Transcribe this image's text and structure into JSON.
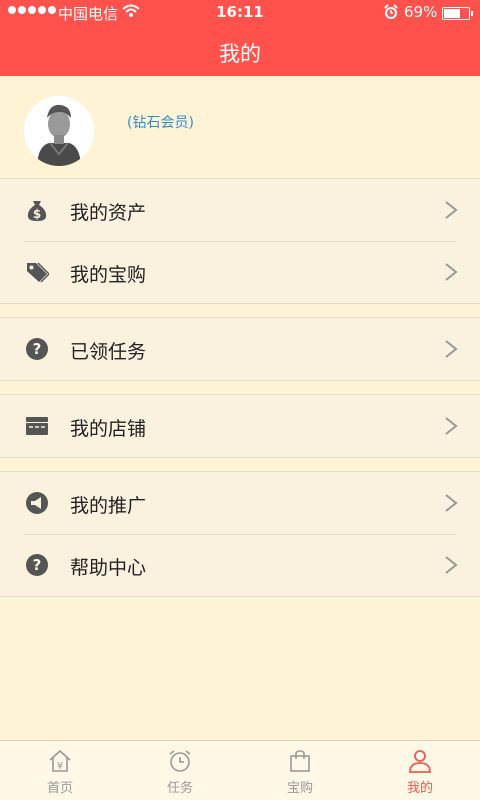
{
  "status_bar": {
    "carrier": "中国电信",
    "time": "16:11",
    "battery_percent": "69%",
    "battery_level": 0.69
  },
  "nav": {
    "title": "我的"
  },
  "profile": {
    "member_level": "(钻石会员)"
  },
  "menu_groups": [
    {
      "items": [
        {
          "label": "我的资产",
          "icon": "money-bag-icon"
        },
        {
          "label": "我的宝购",
          "icon": "tag-icon"
        }
      ]
    },
    {
      "items": [
        {
          "label": "已领任务",
          "icon": "question-circle-icon"
        }
      ]
    },
    {
      "items": [
        {
          "label": "我的店铺",
          "icon": "store-icon"
        }
      ]
    },
    {
      "items": [
        {
          "label": "我的推广",
          "icon": "megaphone-icon"
        },
        {
          "label": "帮助中心",
          "icon": "question-circle-icon"
        }
      ]
    }
  ],
  "tabs": [
    {
      "label": "首页",
      "icon": "home-yen-icon",
      "active": false
    },
    {
      "label": "任务",
      "icon": "alarm-clock-icon",
      "active": false
    },
    {
      "label": "宝购",
      "icon": "shopping-bag-icon",
      "active": false
    },
    {
      "label": "我的",
      "icon": "person-icon",
      "active": true
    }
  ],
  "colors": {
    "accent": "#FF524C",
    "background": "#FFF3D6",
    "member_blue": "#2D8FD2",
    "tab_active": "#F05A4F"
  }
}
